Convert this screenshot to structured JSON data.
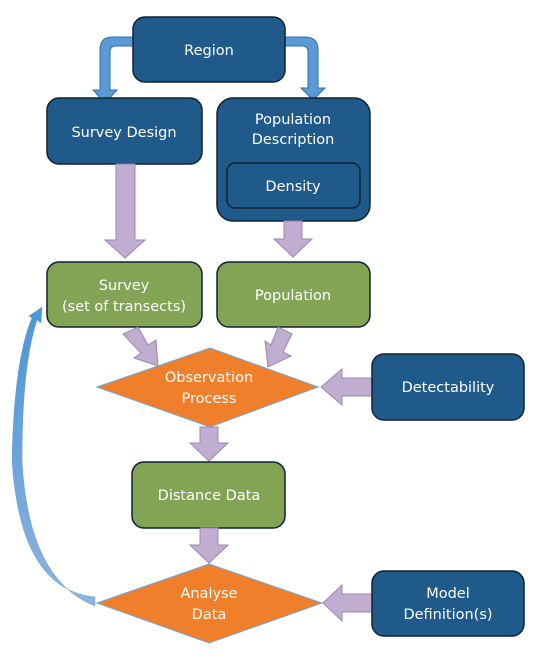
{
  "diagram": {
    "colors": {
      "blue_box": "#1F5A8A",
      "green_box": "#84A455",
      "orange_diamond": "#F07F2C",
      "purple_arrow": "#C0ADCF",
      "blue_arrow": "#5B9BD5",
      "text": "#FFFFFF",
      "border": "#0F2233"
    },
    "nodes": {
      "region": {
        "lines": [
          "Region"
        ]
      },
      "survey_design": {
        "lines": [
          "Survey Design"
        ]
      },
      "population_description": {
        "lines": [
          "Population",
          "Description"
        ]
      },
      "density": {
        "lines": [
          "Density"
        ]
      },
      "survey": {
        "lines": [
          "Survey",
          "(set of transects)"
        ]
      },
      "population": {
        "lines": [
          "Population"
        ]
      },
      "observation_process": {
        "lines": [
          "Observation",
          "Process"
        ]
      },
      "detectability": {
        "lines": [
          "Detectability"
        ]
      },
      "distance_data": {
        "lines": [
          "Distance Data"
        ]
      },
      "analyse_data": {
        "lines": [
          "Analyse",
          "Data"
        ]
      },
      "model_definitions": {
        "lines": [
          "Model",
          "Definition(s)"
        ]
      }
    },
    "edges": [
      {
        "from": "region",
        "to": "survey_design"
      },
      {
        "from": "region",
        "to": "population_description"
      },
      {
        "from": "survey_design",
        "to": "survey"
      },
      {
        "from": "population_description",
        "to": "population"
      },
      {
        "from": "survey",
        "to": "observation_process"
      },
      {
        "from": "population",
        "to": "observation_process"
      },
      {
        "from": "detectability",
        "to": "observation_process"
      },
      {
        "from": "observation_process",
        "to": "distance_data"
      },
      {
        "from": "distance_data",
        "to": "analyse_data"
      },
      {
        "from": "model_definitions",
        "to": "analyse_data"
      },
      {
        "from": "analyse_data",
        "to": "survey"
      }
    ]
  }
}
